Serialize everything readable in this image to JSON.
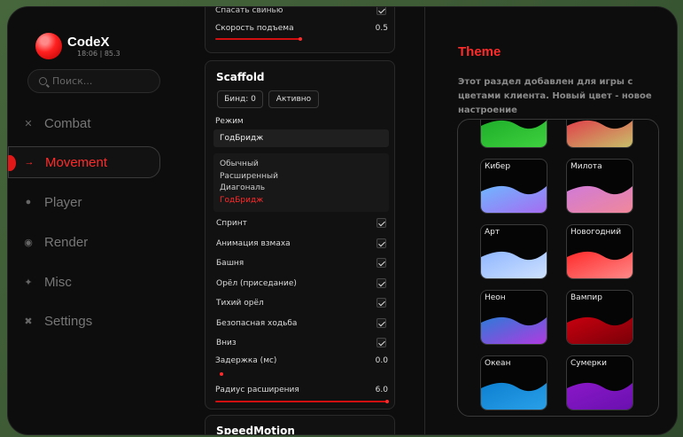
{
  "app": {
    "name": "CodeX",
    "status": "18:06 | 85.3"
  },
  "search": {
    "placeholder": "Поиск..."
  },
  "sidebar": {
    "items": [
      {
        "label": "Combat",
        "icon": "swords-icon",
        "active": false
      },
      {
        "label": "Movement",
        "icon": "arrow-right-icon",
        "active": true
      },
      {
        "label": "Player",
        "icon": "user-icon",
        "active": false
      },
      {
        "label": "Render",
        "icon": "eye-icon",
        "active": false
      },
      {
        "label": "Misc",
        "icon": "star-icon",
        "active": false
      },
      {
        "label": "Settings",
        "icon": "tools-icon",
        "active": false
      }
    ]
  },
  "top_card": {
    "partial_row": "Спасать свинью",
    "speed": {
      "label": "Скорость подъема",
      "value": "0.5",
      "fraction": 0.5
    }
  },
  "scaffold": {
    "title": "Scaffold",
    "bind_label": "Бинд: 0",
    "active_label": "Активно",
    "mode_label": "Режим",
    "mode_value": "ГодБридж",
    "options": [
      "Обычный",
      "Расширенный",
      "Диагональ",
      "ГодБридж"
    ],
    "selected_option": 3,
    "toggles": [
      {
        "label": "Спринт",
        "checked": true
      },
      {
        "label": "Анимация взмаха",
        "checked": true
      },
      {
        "label": "Башня",
        "checked": true
      },
      {
        "label": "Орёл (приседание)",
        "checked": true
      },
      {
        "label": "Тихий орёл",
        "checked": true
      },
      {
        "label": "Безопасная ходьба",
        "checked": true
      },
      {
        "label": "Вниз",
        "checked": true
      }
    ],
    "delay": {
      "label": "Задержка (мс)",
      "value": "0.0",
      "fraction": 0.0
    },
    "radius": {
      "label": "Радиус расширения",
      "value": "6.0",
      "fraction": 1.0
    }
  },
  "speedmotion": {
    "title": "SpeedMotion"
  },
  "theme": {
    "title": "Theme",
    "description": "Этот раздел добавлен для игры с цветами клиента. Новый цвет - новое настроение",
    "tiles": [
      {
        "name": "",
        "colors": [
          "#1fae2a",
          "#3fd13f"
        ]
      },
      {
        "name": "",
        "colors": [
          "#e0404a",
          "#c8c06a"
        ]
      },
      {
        "name": "Кибер",
        "colors": [
          "#6fb6ff",
          "#a56cf2"
        ]
      },
      {
        "name": "Милота",
        "colors": [
          "#d07ad8",
          "#f0889a"
        ]
      },
      {
        "name": "Арт",
        "colors": [
          "#8fb6ff",
          "#cfe2ff"
        ]
      },
      {
        "name": "Новогодний",
        "colors": [
          "#ff2a2a",
          "#ff8a8a"
        ]
      },
      {
        "name": "Неон",
        "colors": [
          "#2d7bd8",
          "#b03ae0"
        ]
      },
      {
        "name": "Вампир",
        "colors": [
          "#c8000f",
          "#7a0008"
        ]
      },
      {
        "name": "Океан",
        "colors": [
          "#0d7fd0",
          "#2aa0e8"
        ]
      },
      {
        "name": "Сумерки",
        "colors": [
          "#8a18c8",
          "#6a10b0"
        ]
      }
    ]
  }
}
